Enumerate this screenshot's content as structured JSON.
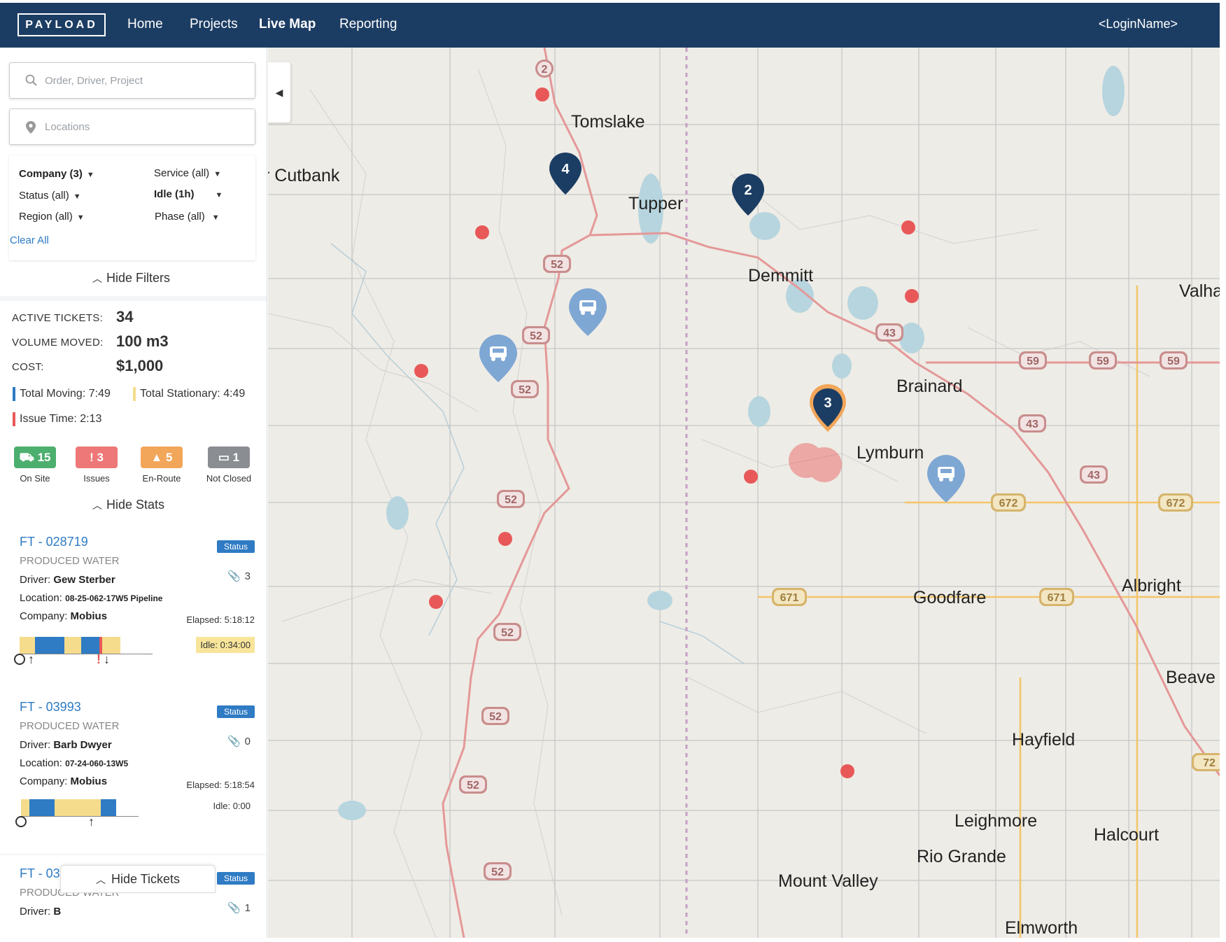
{
  "nav": {
    "brand": "PAYLOAD",
    "links": [
      "Home",
      "Projects",
      "Live Map",
      "Reporting"
    ],
    "active": "Live Map",
    "login": "<LoginName>"
  },
  "search": {
    "order_placeholder": "Order, Driver, Project",
    "locations_placeholder": "Locations"
  },
  "filters": {
    "company": "Company (3)",
    "service": "Service (all)",
    "status": "Status (all)",
    "idle": "Idle (1h)",
    "region": "Region (all)",
    "phase": "Phase (all)",
    "clear_all": "Clear All",
    "hide_filters": "Hide Filters"
  },
  "stats": {
    "active_tickets_label": "ACTIVE TICKETS:",
    "active_tickets": "34",
    "volume_label": "VOLUME MOVED:",
    "volume": "100 m3",
    "cost_label": "COST:",
    "cost": "$1,000",
    "total_moving_label": "Total Moving:",
    "total_moving": "7:49",
    "total_stationary_label": "Total Stationary:",
    "total_stationary": "4:49",
    "issue_time_label": "Issue Time:",
    "issue_time": "2:13",
    "chips": [
      {
        "count": "15",
        "label": "On Site",
        "color": "#4caf6e"
      },
      {
        "count": "3",
        "label": "Issues",
        "color": "#ee7777"
      },
      {
        "count": "5",
        "label": "En-Route",
        "color": "#f2a65a"
      },
      {
        "count": "1",
        "label": "Not Closed",
        "color": "#8a8d91"
      }
    ],
    "hide_stats": "Hide Stats"
  },
  "tickets": [
    {
      "id": "FT - 028719",
      "status": "Status",
      "type": "PRODUCED WATER",
      "driver_label": "Driver:",
      "driver": "Gew Sterber",
      "location_label": "Location:",
      "location": "08-25-062-17W5 Pipeline",
      "company_label": "Company:",
      "company": "Mobius",
      "attachments": "3",
      "elapsed_label": "Elapsed:",
      "elapsed": "5:18:12",
      "idle_label": "Idle:",
      "idle": "0:34:00"
    },
    {
      "id": "FT - 03993",
      "status": "Status",
      "type": "PRODUCED WATER",
      "driver_label": "Driver:",
      "driver": "Barb Dwyer",
      "location_label": "Location:",
      "location": "07-24-060-13W5",
      "company_label": "Company:",
      "company": "Mobius",
      "attachments": "0",
      "elapsed_label": "Elapsed:",
      "elapsed": "5:18:54",
      "idle_label": "Idle:",
      "idle": "0:00"
    },
    {
      "id": "FT - 03993",
      "status": "Status",
      "type": "PRODUCED WATER",
      "driver_label": "Driver:",
      "driver": "B",
      "attachments": "1"
    }
  ],
  "hide_tickets": "Hide Tickets",
  "map": {
    "towns": [
      "Tomslake",
      "r Cutbank",
      "Tupper",
      "Demmitt",
      "Valha",
      "Brainard",
      "Lymburn",
      "Albright",
      "Goodfare",
      "Beave",
      "Hayfield",
      "Leighmore",
      "Halcourt",
      "Rio Grande",
      "Mount Valley",
      "Elmworth"
    ],
    "highway_shields": [
      "2",
      "52",
      "52",
      "52",
      "52",
      "52",
      "52",
      "52",
      "52",
      "43",
      "43",
      "43",
      "59",
      "59",
      "59",
      "672",
      "672",
      "671",
      "671",
      "72"
    ],
    "cluster_markers": [
      "4",
      "2",
      "3"
    ],
    "colors": {
      "navy_marker": "#1c3d63",
      "orange_marker": "#f2a65a",
      "truck_marker": "#7ea7d3",
      "red_dot": "#e85858",
      "highway": "#e49898",
      "road_yellow": "#f3c56b"
    }
  }
}
